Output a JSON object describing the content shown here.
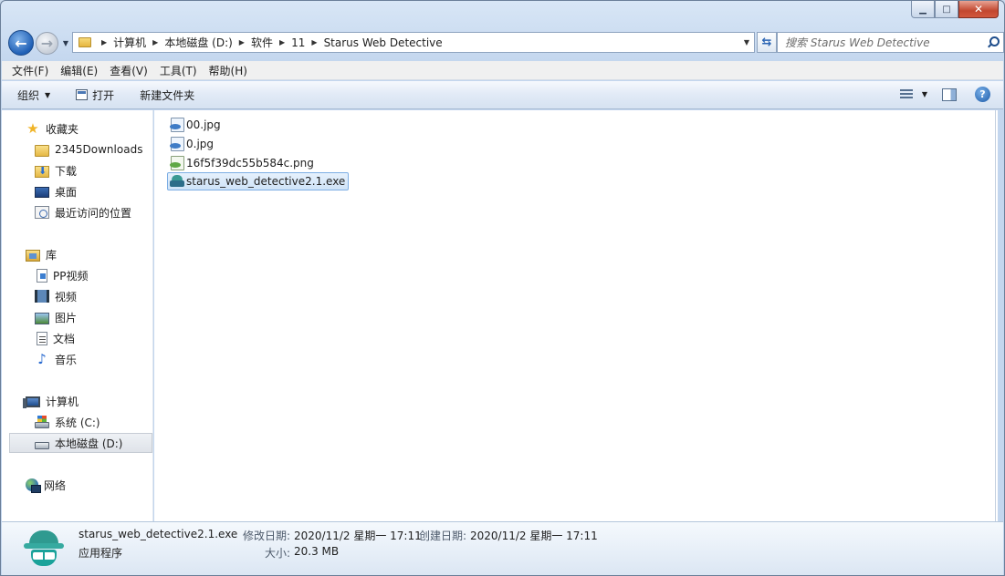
{
  "window": {
    "caption": {
      "minimize": "▁",
      "maximize": "□",
      "close": "✕"
    }
  },
  "address": {
    "crumbs": [
      "计算机",
      "本地磁盘 (D:)",
      "软件",
      "11",
      "Starus Web Detective"
    ]
  },
  "search": {
    "placeholder": "搜索 Starus Web Detective"
  },
  "menu": [
    "文件(F)",
    "编辑(E)",
    "查看(V)",
    "工具(T)",
    "帮助(H)"
  ],
  "commands": {
    "organize": "组织",
    "open": "打开",
    "new_folder": "新建文件夹"
  },
  "sidebar": {
    "favorites": {
      "label": "收藏夹",
      "items": [
        "2345Downloads",
        "下载",
        "桌面",
        "最近访问的位置"
      ]
    },
    "libraries": {
      "label": "库",
      "items": [
        "PP视频",
        "视频",
        "图片",
        "文档",
        "音乐"
      ]
    },
    "computer": {
      "label": "计算机",
      "items": [
        "系统 (C:)",
        "本地磁盘 (D:)"
      ]
    },
    "network": {
      "label": "网络"
    }
  },
  "files": [
    {
      "name": "00.jpg",
      "type": "jpg"
    },
    {
      "name": "0.jpg",
      "type": "jpg"
    },
    {
      "name": "16f5f39dc55b584c.png",
      "type": "png"
    },
    {
      "name": "starus_web_detective2.1.exe",
      "type": "exe",
      "selected": true
    }
  ],
  "details": {
    "name": "starus_web_detective2.1.exe",
    "type": "应用程序",
    "modified_label": "修改日期:",
    "modified_value": "2020/11/2 星期一 17:11",
    "created_label": "创建日期:",
    "created_value": "2020/11/2 星期一 17:11",
    "size_label": "大小:",
    "size_value": "20.3 MB"
  }
}
